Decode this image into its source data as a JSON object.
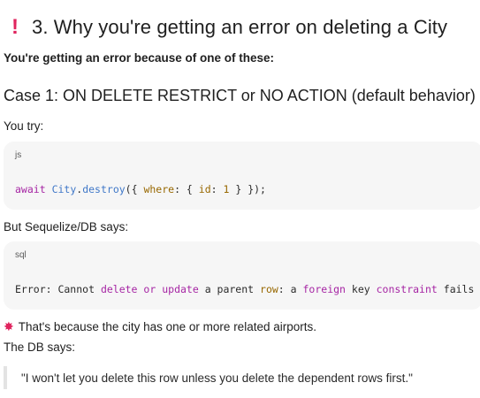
{
  "section": {
    "icon": "exclamation-icon",
    "icon_glyph": "❗",
    "title": "3. Why you're getting an error on deleting a City"
  },
  "intro": "You're getting an error because of one of these:",
  "case1": {
    "heading": "Case 1: ON DELETE RESTRICT or NO ACTION (default behavior)",
    "you_try_label": "You try:",
    "js_block": {
      "lang": "js",
      "code_tokens": {
        "t1": "await",
        "t2": " ",
        "t3": "City",
        "t4": ".",
        "t5": "destroy",
        "t6": "({ ",
        "t7": "where",
        "t8": ": { ",
        "t9": "id",
        "t10": ": ",
        "t11": "1",
        "t12": " } });"
      }
    },
    "db_says_label": "But Sequelize/DB says:",
    "sql_block": {
      "lang": "sql",
      "code_tokens": {
        "t1": "Error: Cannot ",
        "t2": "delete",
        "t3": " ",
        "t4": "or",
        "t5": " ",
        "t6": "update",
        "t7": " a parent ",
        "t8": "row",
        "t9": ": a ",
        "t10": "foreign",
        "t11": " key ",
        "t12": "constraint",
        "t13": " fails"
      }
    },
    "explanation": {
      "icon": "collision-icon",
      "icon_glyph": "💥",
      "text": "That's because the city has one or more related airports."
    },
    "db_says2": "The DB says:",
    "quote": "\"I won't let you delete this row unless you delete the dependent rows first.\""
  }
}
